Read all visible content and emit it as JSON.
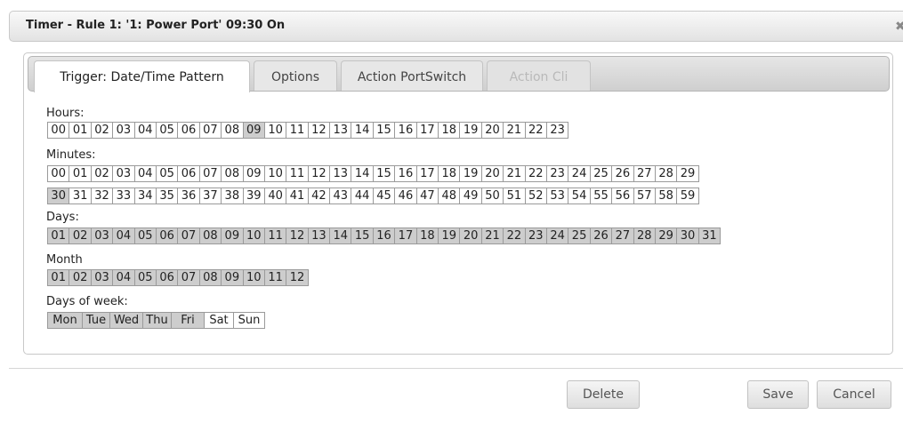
{
  "dialog": {
    "title": "Timer - Rule 1: '1: Power Port' 09:30 On",
    "close_glyph": "✖"
  },
  "tabs": [
    {
      "label": "Trigger: Date/Time Pattern",
      "state": "active"
    },
    {
      "label": "Options",
      "state": "normal"
    },
    {
      "label": "Action PortSwitch",
      "state": "normal"
    },
    {
      "label": "Action Cli",
      "state": "disabled"
    }
  ],
  "hours": {
    "label": "Hours:",
    "values": [
      "00",
      "01",
      "02",
      "03",
      "04",
      "05",
      "06",
      "07",
      "08",
      "09",
      "10",
      "11",
      "12",
      "13",
      "14",
      "15",
      "16",
      "17",
      "18",
      "19",
      "20",
      "21",
      "22",
      "23"
    ],
    "selected": [
      "09"
    ]
  },
  "minutes": {
    "label": "Minutes:",
    "rows": [
      [
        "00",
        "01",
        "02",
        "03",
        "04",
        "05",
        "06",
        "07",
        "08",
        "09",
        "10",
        "11",
        "12",
        "13",
        "14",
        "15",
        "16",
        "17",
        "18",
        "19",
        "20",
        "21",
        "22",
        "23",
        "24",
        "25",
        "26",
        "27",
        "28",
        "29"
      ],
      [
        "30",
        "31",
        "32",
        "33",
        "34",
        "35",
        "36",
        "37",
        "38",
        "39",
        "40",
        "41",
        "42",
        "43",
        "44",
        "45",
        "46",
        "47",
        "48",
        "49",
        "50",
        "51",
        "52",
        "53",
        "54",
        "55",
        "56",
        "57",
        "58",
        "59"
      ]
    ],
    "selected": [
      "30"
    ]
  },
  "days": {
    "label": "Days:",
    "values": [
      "01",
      "02",
      "03",
      "04",
      "05",
      "06",
      "07",
      "08",
      "09",
      "10",
      "11",
      "12",
      "13",
      "14",
      "15",
      "16",
      "17",
      "18",
      "19",
      "20",
      "21",
      "22",
      "23",
      "24",
      "25",
      "26",
      "27",
      "28",
      "29",
      "30",
      "31"
    ],
    "selected": [
      "01",
      "02",
      "03",
      "04",
      "05",
      "06",
      "07",
      "08",
      "09",
      "10",
      "11",
      "12",
      "13",
      "14",
      "15",
      "16",
      "17",
      "18",
      "19",
      "20",
      "21",
      "22",
      "23",
      "24",
      "25",
      "26",
      "27",
      "28",
      "29",
      "30",
      "31"
    ]
  },
  "month": {
    "label": "Month",
    "values": [
      "01",
      "02",
      "03",
      "04",
      "05",
      "06",
      "07",
      "08",
      "09",
      "10",
      "11",
      "12"
    ],
    "selected": [
      "01",
      "02",
      "03",
      "04",
      "05",
      "06",
      "07",
      "08",
      "09",
      "10",
      "11",
      "12"
    ]
  },
  "weekdays": {
    "label": "Days of week:",
    "values": [
      "Mon",
      "Tue",
      "Wed",
      "Thu",
      "Fri",
      "Sat",
      "Sun"
    ],
    "selected": [
      "Mon",
      "Tue",
      "Wed",
      "Thu",
      "Fri"
    ]
  },
  "footer": {
    "delete_label": "Delete",
    "save_label": "Save",
    "cancel_label": "Cancel"
  },
  "colors": {
    "selected_cell": "#cdcdcd",
    "border": "#9a9a9a"
  }
}
